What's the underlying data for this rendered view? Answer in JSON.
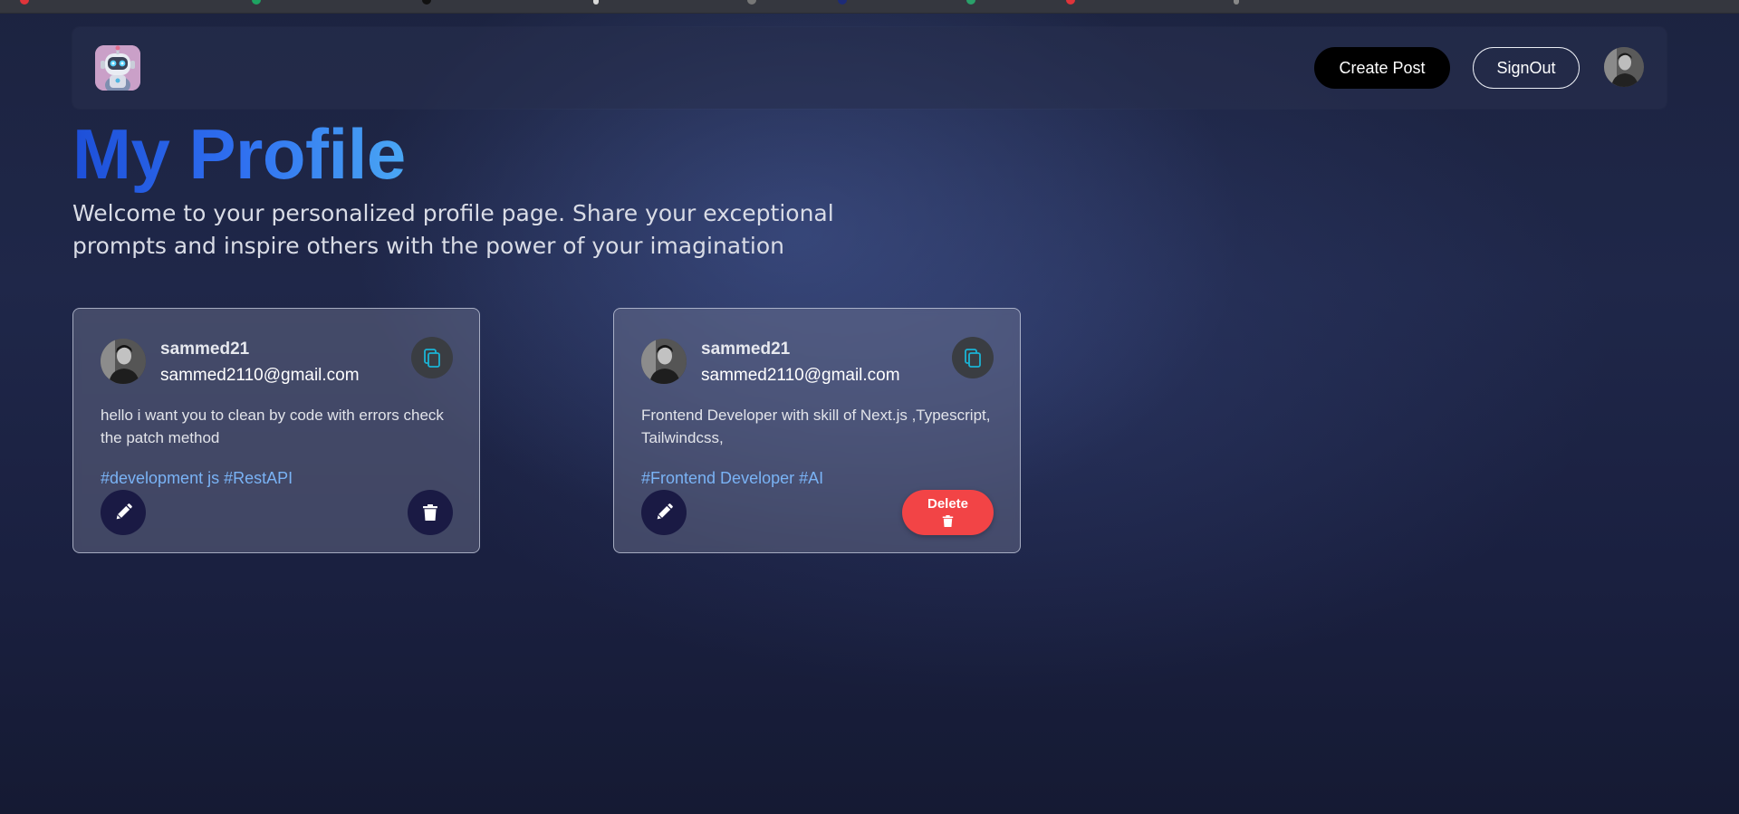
{
  "navbar": {
    "create_post_label": "Create Post",
    "signout_label": "SignOut"
  },
  "page": {
    "title": "My Profile",
    "description": "Welcome to your personalized profile page. Share your exceptional prompts and inspire others with the power of your imagination"
  },
  "posts": [
    {
      "username": "sammed21",
      "email": "sammed2110@gmail.com",
      "prompt": "hello i want you to clean by code with errors check the patch method",
      "tags": "#development js #RestAPI"
    },
    {
      "username": "sammed21",
      "email": "sammed2110@gmail.com",
      "prompt": "Frontend Developer with skill of Next.js ,Typescript, Tailwindcss,",
      "tags": "#Frontend Developer #AI",
      "delete_label": "Delete"
    }
  ],
  "icons": {
    "logo": "robot-logo-icon",
    "copy": "copy-icon",
    "edit": "pencil-icon",
    "delete": "trash-icon"
  },
  "colors": {
    "title_gradient_start": "#1d4fd8",
    "title_gradient_end": "#4aa7f4",
    "tag_color": "#7ab3f5",
    "action_button_bg": "#1a1a44",
    "delete_hover_bg": "#f24446"
  }
}
